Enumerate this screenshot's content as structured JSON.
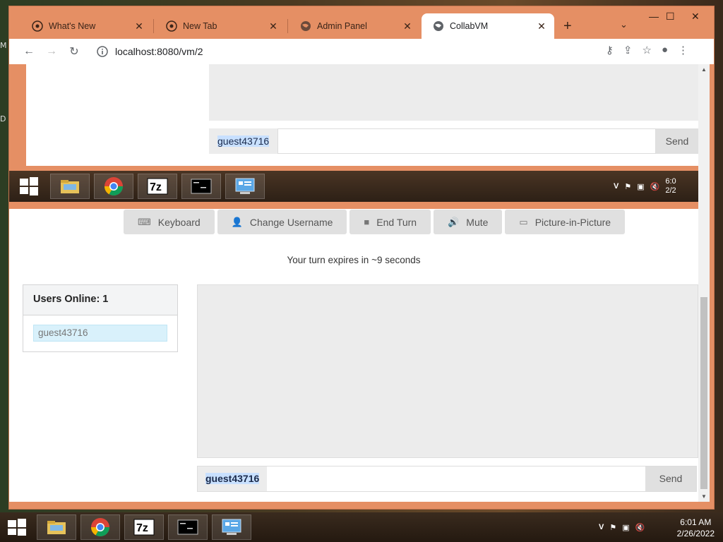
{
  "desktop": {
    "fragment_top": "M",
    "fragment_bottom": "D"
  },
  "browser": {
    "tabs": [
      {
        "title": "What's New",
        "icon": "chrome-icon"
      },
      {
        "title": "New Tab",
        "icon": "chrome-icon"
      },
      {
        "title": "Admin Panel",
        "icon": "globe-icon"
      },
      {
        "title": "CollabVM",
        "icon": "globe-icon",
        "active": true
      }
    ],
    "url": "localhost:8080/vm/2"
  },
  "vm": {
    "chat_username": "guest43716",
    "send_label": "Send",
    "tray_time": "6:0",
    "tray_date": "2/2"
  },
  "controls": {
    "keyboard": "Keyboard",
    "change_username": "Change Username",
    "end_turn": "End Turn",
    "mute": "Mute",
    "pip": "Picture-in-Picture"
  },
  "turn_status": "Your turn expires in ~9 seconds",
  "users": {
    "heading": "Users Online: 1",
    "list": [
      "guest43716"
    ]
  },
  "chat": {
    "username": "guest43716",
    "send_label": "Send"
  },
  "host": {
    "time": "6:01 AM",
    "date": "2/26/2022"
  },
  "colors": {
    "chrome_frame": "#e58f64",
    "button_bg": "#e0e0e0",
    "user_highlight": "#d9f1fb"
  }
}
